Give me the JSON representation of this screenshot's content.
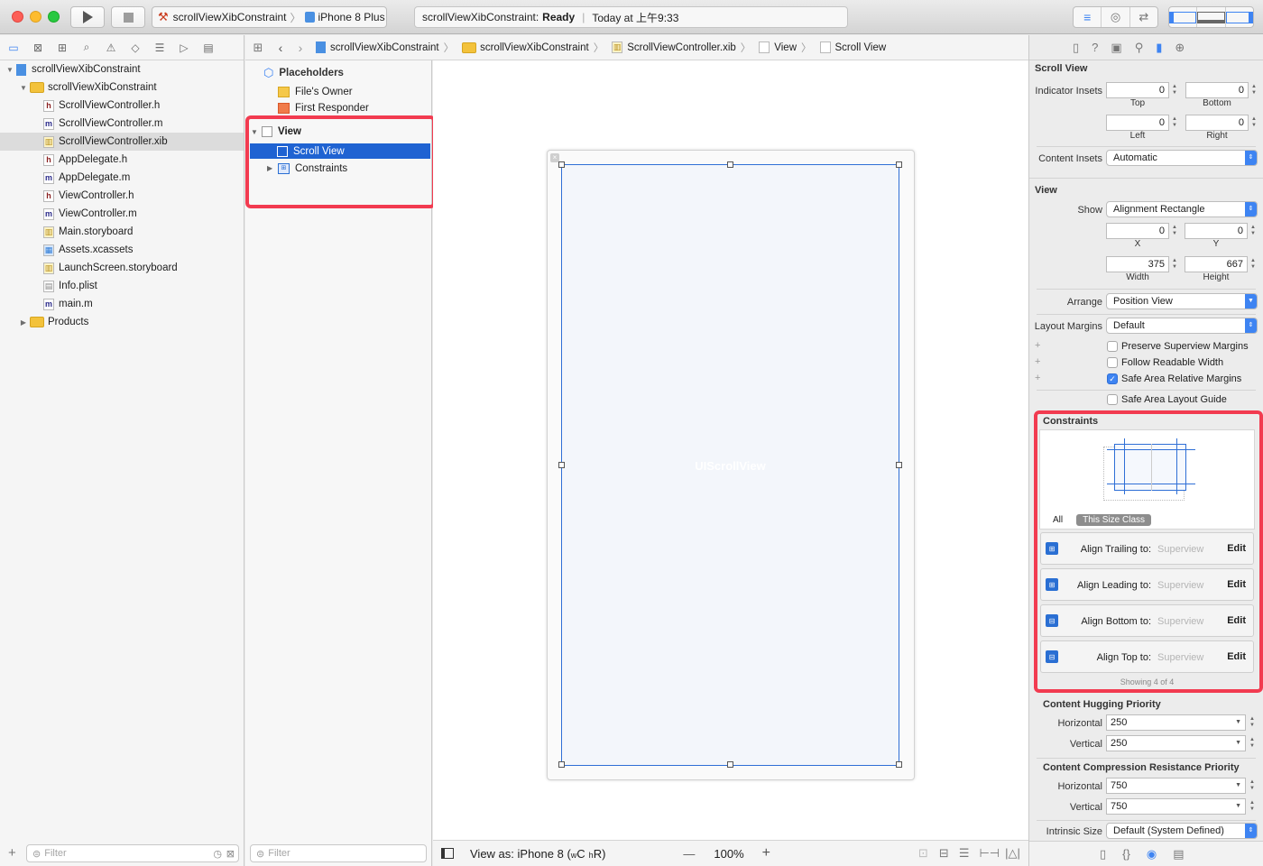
{
  "toolbar": {
    "scheme_name": "scrollViewXibConstraint",
    "device": "iPhone 8 Plus",
    "status_project": "scrollViewXibConstraint:",
    "status_state": "Ready",
    "status_time": "Today at 上午9:33"
  },
  "navigator": {
    "items": [
      {
        "label": "scrollViewXibConstraint",
        "kind": "project",
        "level": 0
      },
      {
        "label": "scrollViewXibConstraint",
        "kind": "folder",
        "level": 1
      },
      {
        "label": "ScrollViewController.h",
        "kind": "h",
        "level": 2
      },
      {
        "label": "ScrollViewController.m",
        "kind": "m",
        "level": 2
      },
      {
        "label": "ScrollViewController.xib",
        "kind": "xib",
        "level": 2,
        "selected": true
      },
      {
        "label": "AppDelegate.h",
        "kind": "h",
        "level": 2
      },
      {
        "label": "AppDelegate.m",
        "kind": "m",
        "level": 2
      },
      {
        "label": "ViewController.h",
        "kind": "h",
        "level": 2
      },
      {
        "label": "ViewController.m",
        "kind": "m",
        "level": 2
      },
      {
        "label": "Main.storyboard",
        "kind": "storyboard",
        "level": 2
      },
      {
        "label": "Assets.xcassets",
        "kind": "assets",
        "level": 2
      },
      {
        "label": "LaunchScreen.storyboard",
        "kind": "storyboard",
        "level": 2
      },
      {
        "label": "Info.plist",
        "kind": "plist",
        "level": 2
      },
      {
        "label": "main.m",
        "kind": "m",
        "level": 2
      },
      {
        "label": "Products",
        "kind": "folder",
        "level": 1
      }
    ],
    "filter_placeholder": "Filter"
  },
  "jumpbar": {
    "crumbs": [
      "scrollViewXibConstraint",
      "scrollViewXibConstraint",
      "ScrollViewController.xib",
      "View",
      "Scroll View"
    ]
  },
  "outline": {
    "placeholders": "Placeholders",
    "files_owner": "File's Owner",
    "first_responder": "First Responder",
    "view": "View",
    "scroll_view": "Scroll View",
    "constraints": "Constraints",
    "filter_placeholder": "Filter"
  },
  "canvas": {
    "scrollview_label": "UIScrollView",
    "view_as": "View as: iPhone 8 (",
    "size_w": "w",
    "size_c": "C",
    "size_h": "h",
    "size_r": "R)",
    "zoom": "100%",
    "zoom_out": "—",
    "zoom_in": "+"
  },
  "inspector": {
    "scroll_view_title": "Scroll View",
    "indicator_insets": "Indicator Insets",
    "top": "0",
    "top_label": "Top",
    "bottom": "0",
    "bottom_label": "Bottom",
    "left": "0",
    "left_label": "Left",
    "right": "0",
    "right_label": "Right",
    "content_insets_label": "Content Insets",
    "content_insets_value": "Automatic",
    "view_title": "View",
    "show_label": "Show",
    "show_value": "Alignment Rectangle",
    "x": "0",
    "x_label": "X",
    "y": "0",
    "y_label": "Y",
    "width": "375",
    "width_label": "Width",
    "height": "667",
    "height_label": "Height",
    "arrange_label": "Arrange",
    "arrange_value": "Position View",
    "layout_margins_label": "Layout Margins",
    "layout_margins_value": "Default",
    "preserve_superview": "Preserve Superview Margins",
    "follow_readable": "Follow Readable Width",
    "safe_area_relative": "Safe Area Relative Margins",
    "safe_area_guide": "Safe Area Layout Guide",
    "constraints_title": "Constraints",
    "tab_all": "All",
    "tab_size_class": "This Size Class",
    "constraints": [
      {
        "title": "Align Trailing to:",
        "target": "Superview",
        "edit": "Edit"
      },
      {
        "title": "Align Leading to:",
        "target": "Superview",
        "edit": "Edit"
      },
      {
        "title": "Align Bottom to:",
        "target": "Superview",
        "edit": "Edit"
      },
      {
        "title": "Align Top to:",
        "target": "Superview",
        "edit": "Edit"
      }
    ],
    "showing": "Showing 4 of 4",
    "hugging_title": "Content Hugging Priority",
    "horizontal_label": "Horizontal",
    "vertical_label": "Vertical",
    "hugging_h": "250",
    "hugging_v": "250",
    "compression_title": "Content Compression Resistance Priority",
    "compression_h": "750",
    "compression_v": "750",
    "intrinsic_label": "Intrinsic Size",
    "intrinsic_value": "Default (System Defined)"
  },
  "colors": {
    "accent": "#3e84f2",
    "highlight": "#f23b50",
    "selection": "#1f63d2"
  }
}
